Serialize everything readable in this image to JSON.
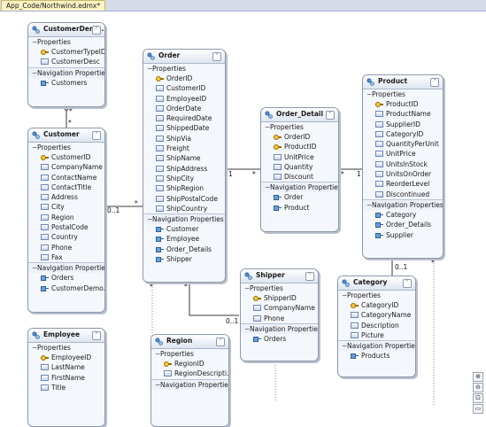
{
  "document_tab": "App_Code/Northwind.edmx*",
  "section_labels": {
    "properties": "Properties",
    "navigation": "Navigation Properties"
  },
  "entities": [
    {
      "id": "customerdemographic",
      "name": "CustomerDem...",
      "properties": [
        {
          "name": "CustomerTypeID",
          "key": true
        },
        {
          "name": "CustomerDesc",
          "key": false
        }
      ],
      "navigation": [
        "Customers"
      ]
    },
    {
      "id": "customer",
      "name": "Customer",
      "properties": [
        {
          "name": "CustomerID",
          "key": true
        },
        {
          "name": "CompanyName",
          "key": false
        },
        {
          "name": "ContactName",
          "key": false
        },
        {
          "name": "ContactTitle",
          "key": false
        },
        {
          "name": "Address",
          "key": false
        },
        {
          "name": "City",
          "key": false
        },
        {
          "name": "Region",
          "key": false
        },
        {
          "name": "PostalCode",
          "key": false
        },
        {
          "name": "Country",
          "key": false
        },
        {
          "name": "Phone",
          "key": false
        },
        {
          "name": "Fax",
          "key": false
        }
      ],
      "navigation": [
        "Orders",
        "CustomerDemo..."
      ]
    },
    {
      "id": "order",
      "name": "Order",
      "properties": [
        {
          "name": "OrderID",
          "key": true
        },
        {
          "name": "CustomerID",
          "key": false
        },
        {
          "name": "EmployeeID",
          "key": false
        },
        {
          "name": "OrderDate",
          "key": false
        },
        {
          "name": "RequiredDate",
          "key": false
        },
        {
          "name": "ShippedDate",
          "key": false
        },
        {
          "name": "ShipVia",
          "key": false
        },
        {
          "name": "Freight",
          "key": false
        },
        {
          "name": "ShipName",
          "key": false
        },
        {
          "name": "ShipAddress",
          "key": false
        },
        {
          "name": "ShipCity",
          "key": false
        },
        {
          "name": "ShipRegion",
          "key": false
        },
        {
          "name": "ShipPostalCode",
          "key": false
        },
        {
          "name": "ShipCountry",
          "key": false
        }
      ],
      "navigation": [
        "Customer",
        "Employee",
        "Order_Details",
        "Shipper"
      ]
    },
    {
      "id": "orderdetail",
      "name": "Order_Detail",
      "properties": [
        {
          "name": "OrderID",
          "key": true
        },
        {
          "name": "ProductID",
          "key": true
        },
        {
          "name": "UnitPrice",
          "key": false
        },
        {
          "name": "Quantity",
          "key": false
        },
        {
          "name": "Discount",
          "key": false
        }
      ],
      "navigation": [
        "Order",
        "Product"
      ]
    },
    {
      "id": "product",
      "name": "Product",
      "properties": [
        {
          "name": "ProductID",
          "key": true
        },
        {
          "name": "ProductName",
          "key": false
        },
        {
          "name": "SupplierID",
          "key": false
        },
        {
          "name": "CategoryID",
          "key": false
        },
        {
          "name": "QuantityPerUnit",
          "key": false
        },
        {
          "name": "UnitPrice",
          "key": false
        },
        {
          "name": "UnitsInStock",
          "key": false
        },
        {
          "name": "UnitsOnOrder",
          "key": false
        },
        {
          "name": "ReorderLevel",
          "key": false
        },
        {
          "name": "Discontinued",
          "key": false
        }
      ],
      "navigation": [
        "Category",
        "Order_Details",
        "Supplier"
      ]
    },
    {
      "id": "shipper",
      "name": "Shipper",
      "properties": [
        {
          "name": "ShipperID",
          "key": true
        },
        {
          "name": "CompanyName",
          "key": false
        },
        {
          "name": "Phone",
          "key": false
        }
      ],
      "navigation": [
        "Orders"
      ]
    },
    {
      "id": "category",
      "name": "Category",
      "properties": [
        {
          "name": "CategoryID",
          "key": true
        },
        {
          "name": "CategoryName",
          "key": false
        },
        {
          "name": "Description",
          "key": false
        },
        {
          "name": "Picture",
          "key": false
        }
      ],
      "navigation": [
        "Products"
      ]
    },
    {
      "id": "employee",
      "name": "Employee",
      "properties": [
        {
          "name": "EmployeeID",
          "key": true
        },
        {
          "name": "LastName",
          "key": false
        },
        {
          "name": "FirstName",
          "key": false
        },
        {
          "name": "Title",
          "key": false
        }
      ],
      "navigation": []
    },
    {
      "id": "region",
      "name": "Region",
      "properties": [
        {
          "name": "RegionID",
          "key": true
        },
        {
          "name": "RegionDescripti...",
          "key": false
        }
      ],
      "navigation": []
    }
  ],
  "multiplicities": [
    "*",
    "*",
    "0..1",
    "*",
    "1",
    "*",
    "*",
    "1",
    "*",
    "0..1",
    "*",
    "*",
    "0..1"
  ],
  "icons": {
    "entity": "entity-type-icon",
    "key": "key-property-icon",
    "property": "scalar-property-icon",
    "navigation": "navigation-property-icon",
    "collapse": "collapse-chevron-icon"
  },
  "zoom_controls": [
    "⊕",
    "⊖",
    "⊡",
    "▭"
  ]
}
